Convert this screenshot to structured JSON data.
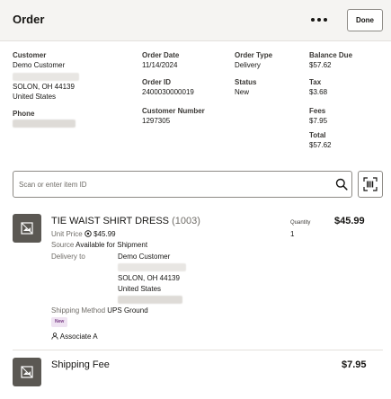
{
  "header": {
    "title": "Order",
    "done_label": "Done"
  },
  "order": {
    "customer_label": "Customer",
    "customer_name": "Demo Customer",
    "city_line": "SOLON, OH 44139",
    "country": "United States",
    "phone_label": "Phone",
    "order_date_label": "Order Date",
    "order_date": "11/14/2024",
    "order_id_label": "Order ID",
    "order_id": "2400030000019",
    "customer_number_label": "Customer Number",
    "customer_number": "1297305",
    "order_type_label": "Order Type",
    "order_type": "Delivery",
    "status_label": "Status",
    "status": "New",
    "balance_due_label": "Balance Due",
    "balance_due": "$57.62",
    "tax_label": "Tax",
    "tax": "$3.68",
    "fees_label": "Fees",
    "fees": "$7.95",
    "total_label": "Total",
    "total": "$57.62"
  },
  "search": {
    "placeholder": "Scan or enter item ID"
  },
  "line_item": {
    "name": "TIE WAIST SHIRT DRESS",
    "code": "(1003)",
    "unit_price_label": "Unit Price",
    "unit_price": "$45.99",
    "source_label": "Source",
    "source": "Available for Shipment",
    "delivery_label": "Delivery to",
    "delivery_name": "Demo Customer",
    "delivery_city": "SOLON, OH 44139",
    "delivery_country": "United States",
    "shipping_method_label": "Shipping Method",
    "shipping_method": "UPS Ground",
    "badge": "New",
    "associate": "Associate A",
    "quantity_label": "Quantity",
    "quantity": "1",
    "price": "$45.99"
  },
  "fee_item": {
    "name": "Shipping Fee",
    "price": "$7.95"
  },
  "colors": {
    "header_bg": "#f5f4f2",
    "thumb_bg": "#5b5853",
    "badge_bg": "#efe3f2"
  },
  "icons": {
    "more": "more-horizontal-icon",
    "search": "search-icon",
    "scan": "barcode-scan-icon",
    "thumb": "image-placeholder-icon",
    "person": "person-icon",
    "price_info": "info-icon"
  }
}
